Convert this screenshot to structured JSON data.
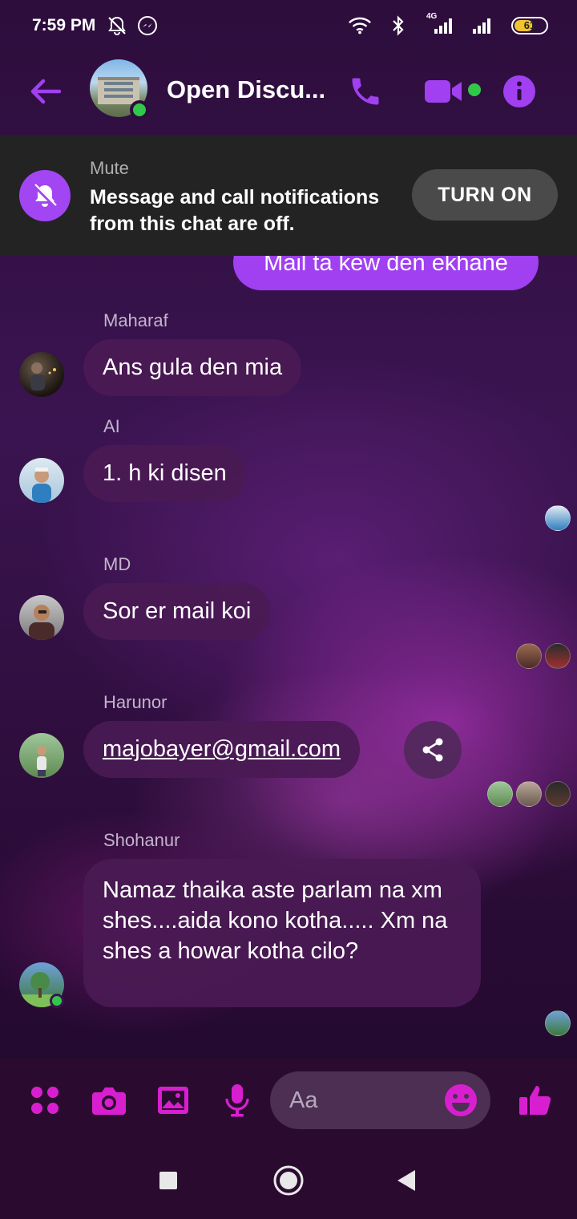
{
  "status_bar": {
    "time": "7:59 PM",
    "network_label": "4G",
    "battery": "61",
    "battery_fraction": 0.61,
    "icons": [
      "silent-icon",
      "messenger-icon",
      "wifi-icon",
      "bluetooth-icon",
      "signal-icon",
      "battery-icon"
    ]
  },
  "header": {
    "title": "Open Discu...",
    "icons": [
      "back-arrow-icon",
      "phone-icon",
      "video-camera-icon",
      "info-icon"
    ],
    "accent": "#a040f0"
  },
  "mute_banner": {
    "title": "Mute",
    "text": "Message and call notifications from this chat are off.",
    "button": "TURN ON"
  },
  "messages": {
    "outgoing_partial": "Mail ta kew den ekhane",
    "m1": {
      "sender": "Maharaf",
      "text": "Ans gula den mia"
    },
    "m2": {
      "sender": "AI",
      "text": "1. h ki disen"
    },
    "m3": {
      "sender": "MD",
      "text": "Sor er mail koi"
    },
    "m4": {
      "sender": "Harunor",
      "text": "majobayer@gmail.com"
    },
    "m5": {
      "sender": "Shohanur",
      "text": "Namaz thaika aste parlam na xm shes....aida kono kotha..... Xm na shes a howar kotha cilo?"
    }
  },
  "composer": {
    "placeholder": "Aa",
    "icons": [
      "menu-dots-icon",
      "camera-icon",
      "gallery-icon",
      "microphone-icon",
      "emoji-icon",
      "thumbs-up-icon"
    ],
    "icon_color": "#d81fd0"
  },
  "nav": {
    "icons": [
      "recents-icon",
      "home-icon",
      "back-icon"
    ]
  }
}
